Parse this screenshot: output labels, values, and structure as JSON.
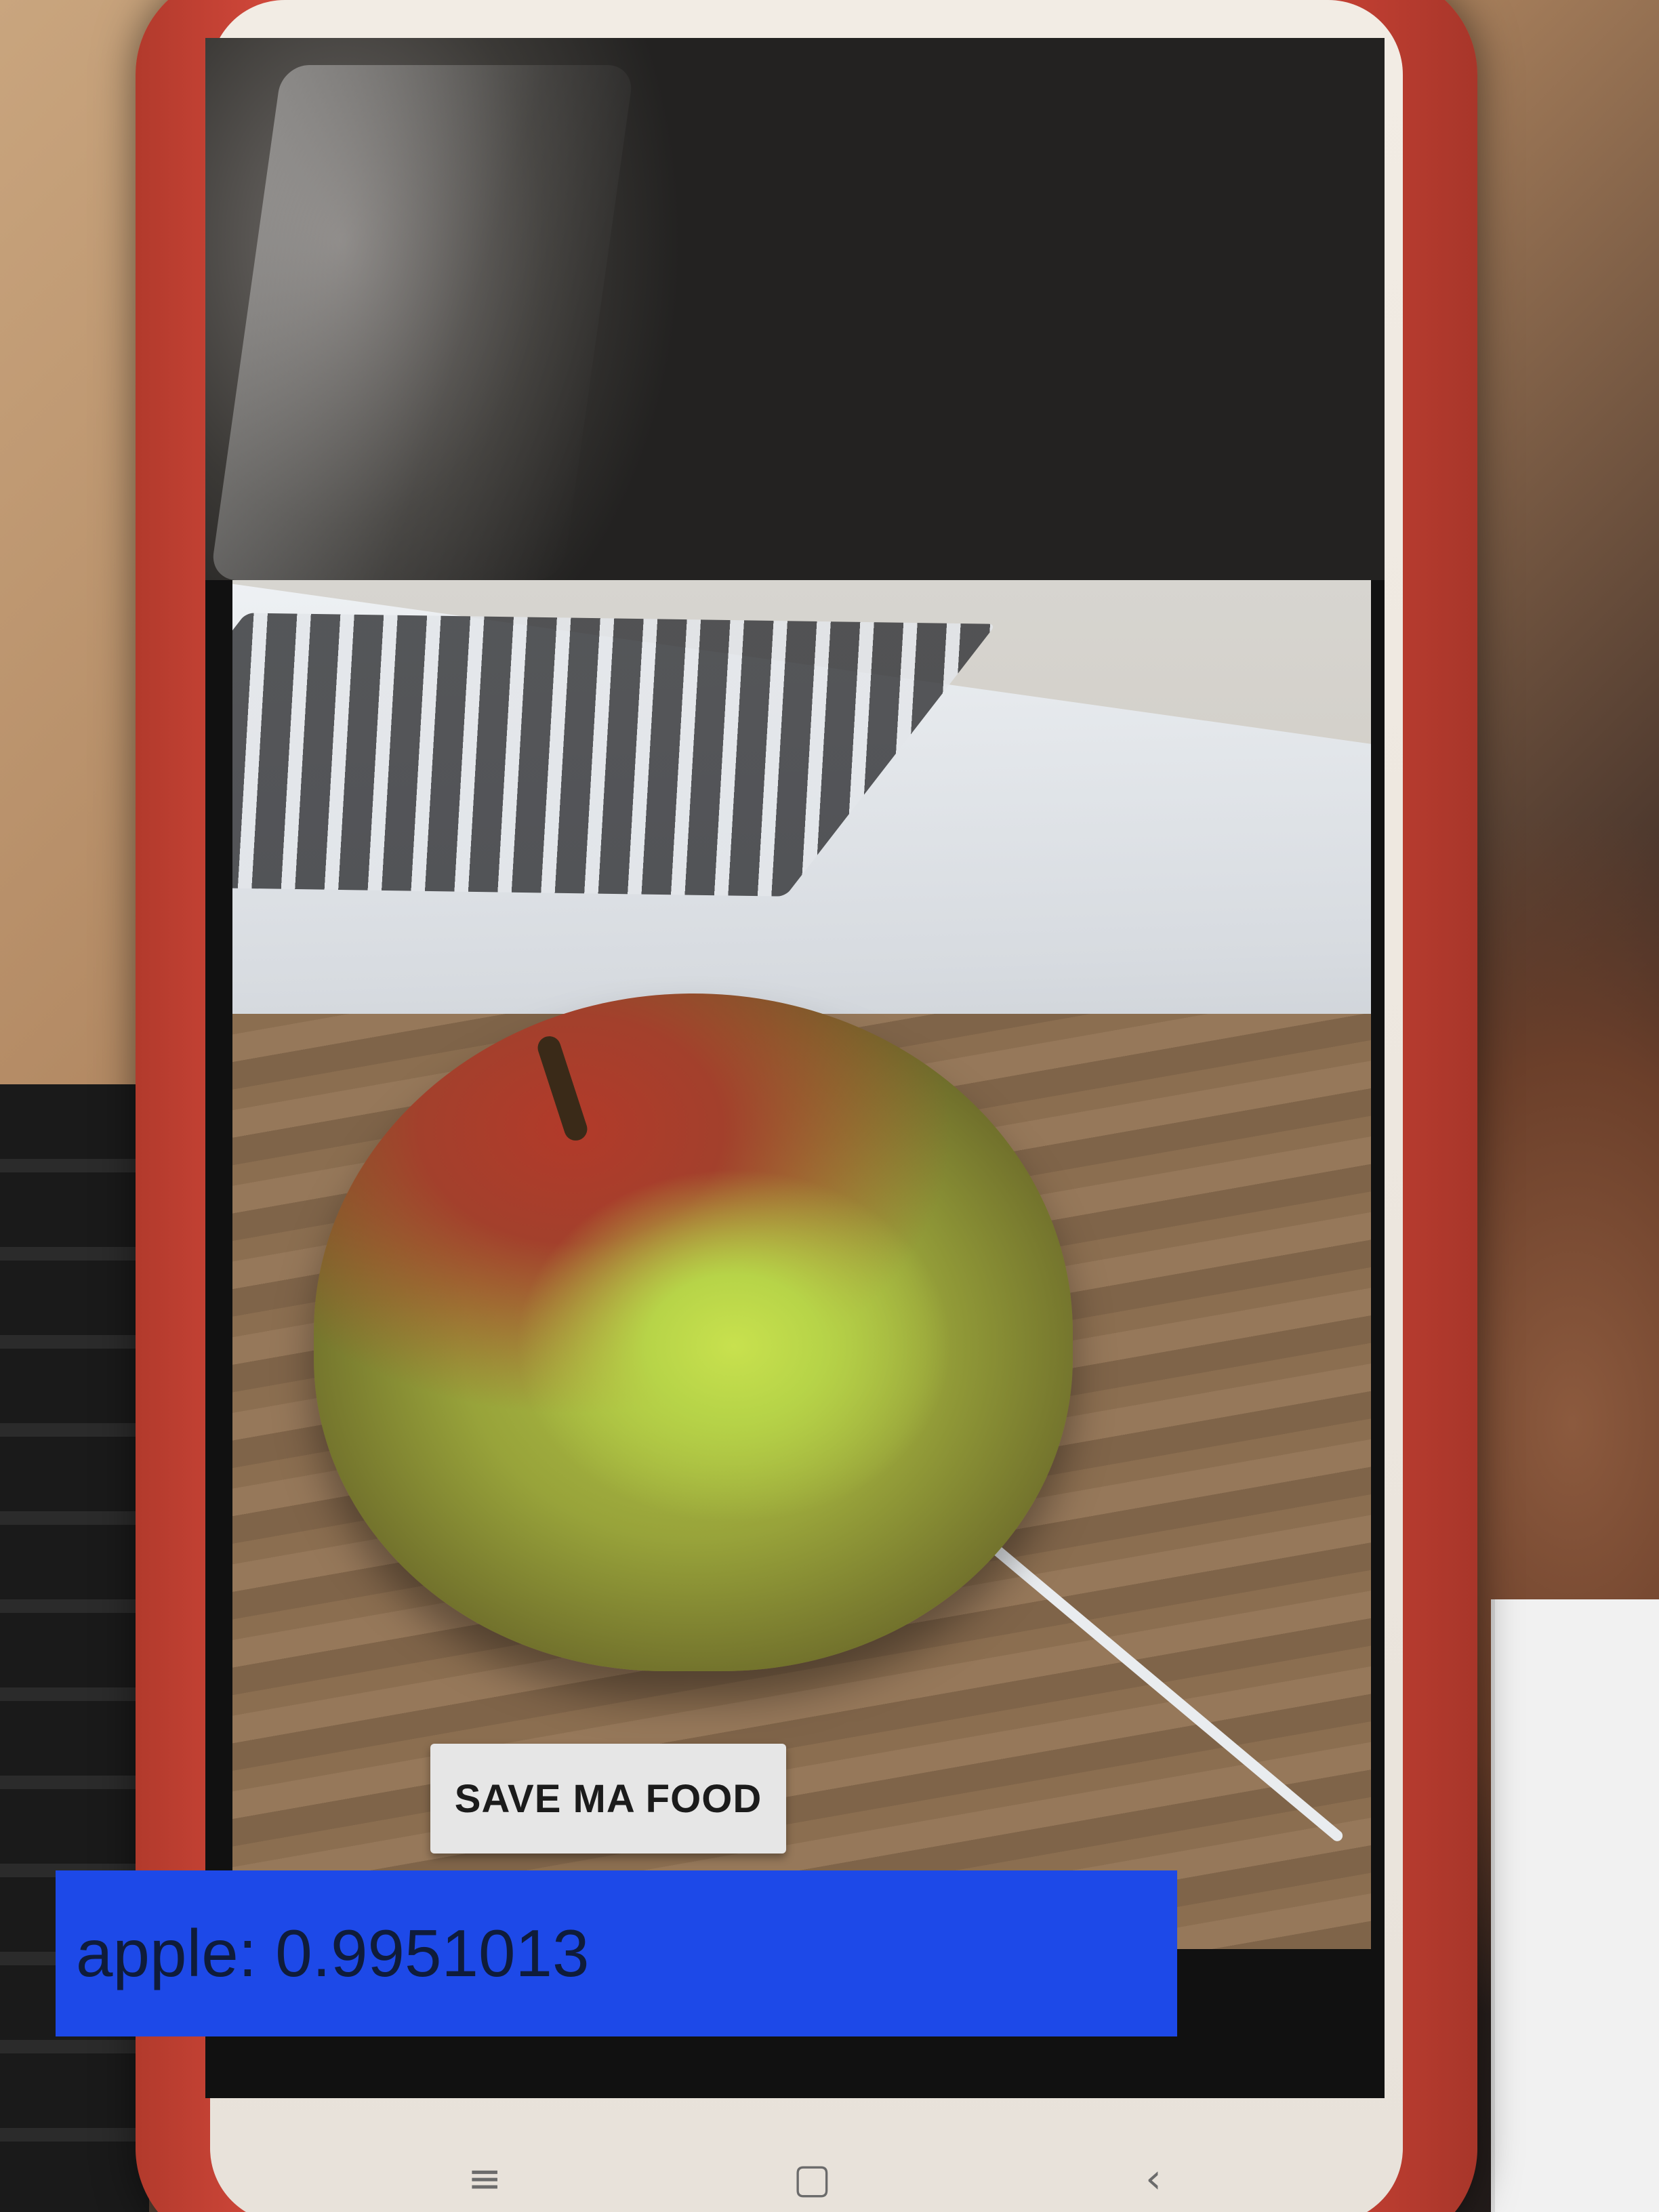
{
  "app": {
    "primary_button_label": "SAVE MA FOOD",
    "prediction_text": "apple: 0.9951013"
  },
  "icons": {
    "nav_menu": "menu-icon",
    "nav_home": "home-icon",
    "nav_back": "back-icon"
  },
  "colors": {
    "result_bar": "#1d49e8",
    "button_bg": "#e6e6e6",
    "phone_case": "#c13f32"
  }
}
